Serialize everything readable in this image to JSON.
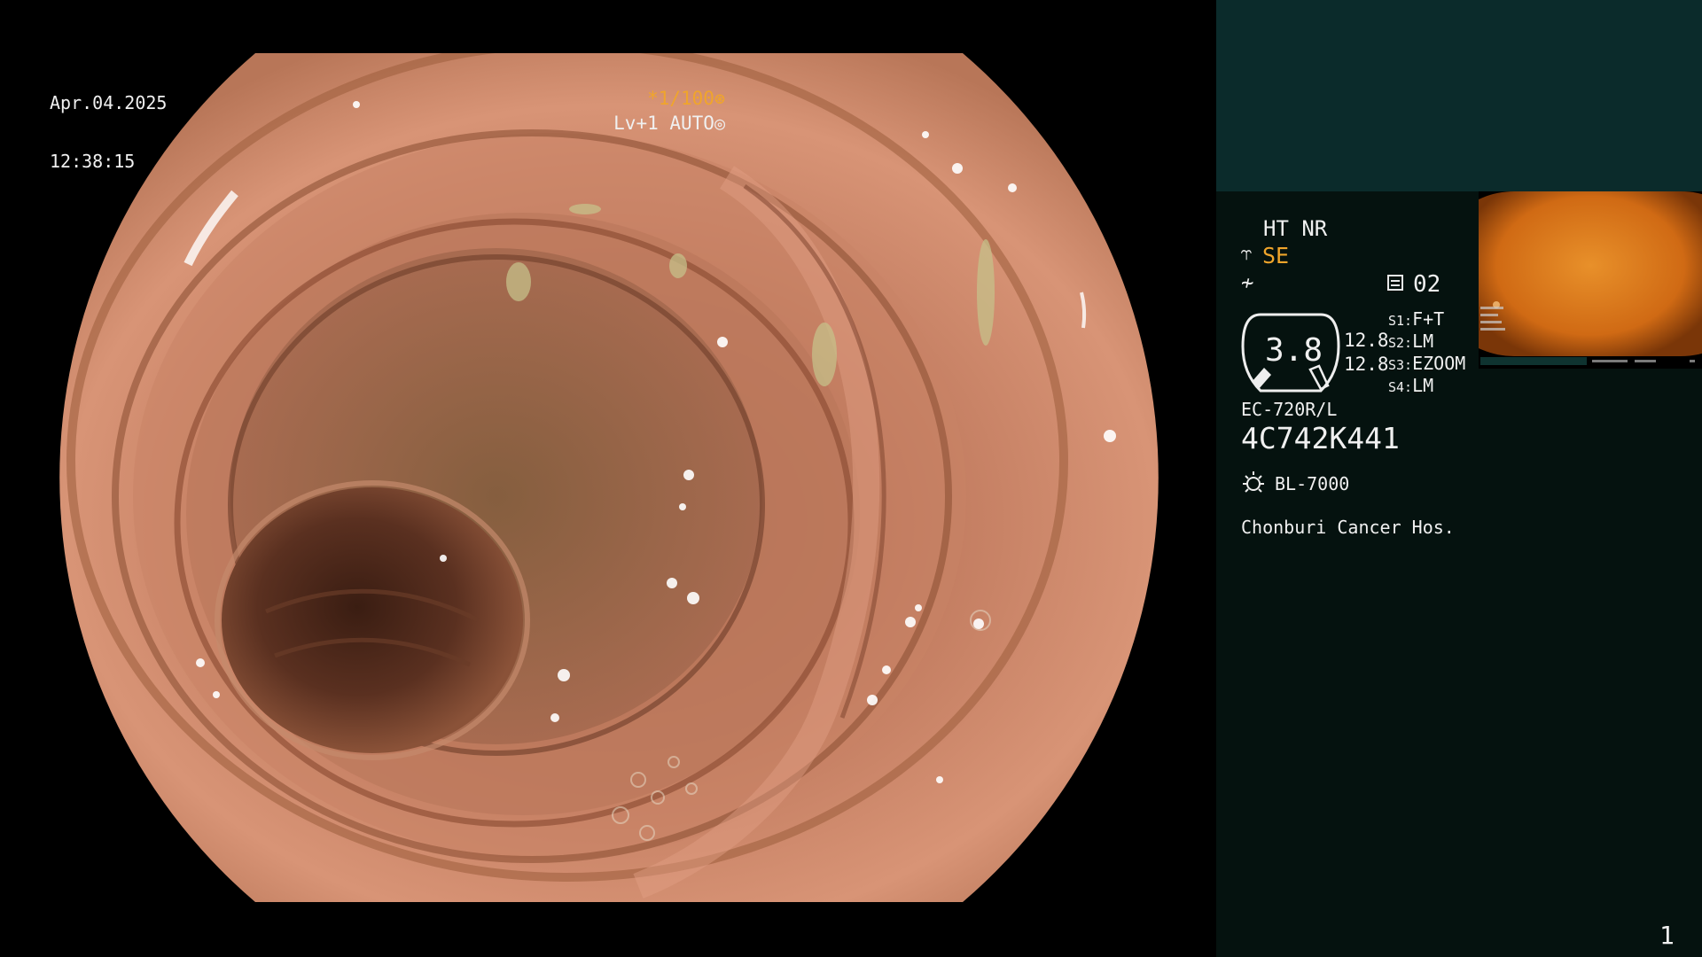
{
  "osd": {
    "date": "Apr.04.2025",
    "time": "12:38:15",
    "shutter": "*1/100",
    "shutter_icon": "aperture-icon",
    "level": "Lv+1 AUTO",
    "level_icon": "iris-icon"
  },
  "panel": {
    "enhancement": "HT NR",
    "structure_mode": "SE",
    "preset_icon": "preset-list-icon",
    "preset_value": "02",
    "gauge_value": "3.8",
    "readout_1": "12.8",
    "readout_2": "12.8",
    "scope_switches": [
      {
        "key": "S1:",
        "value": "F+T"
      },
      {
        "key": "S2:",
        "value": "LM"
      },
      {
        "key": "S3:",
        "value": "EZOOM"
      },
      {
        "key": "S4:",
        "value": "LM"
      }
    ],
    "scope_model": "EC-720R/L",
    "scope_serial": "4C742K441",
    "lamp_model": "BL-7000",
    "hospital": "Chonburi Cancer Hos.",
    "page_number": "1"
  },
  "colors": {
    "accent_orange": "#f0a52b",
    "panel_bg": "#05120f",
    "panel_top_band": "#0b2b2b",
    "mucosa": "#c8846a"
  }
}
